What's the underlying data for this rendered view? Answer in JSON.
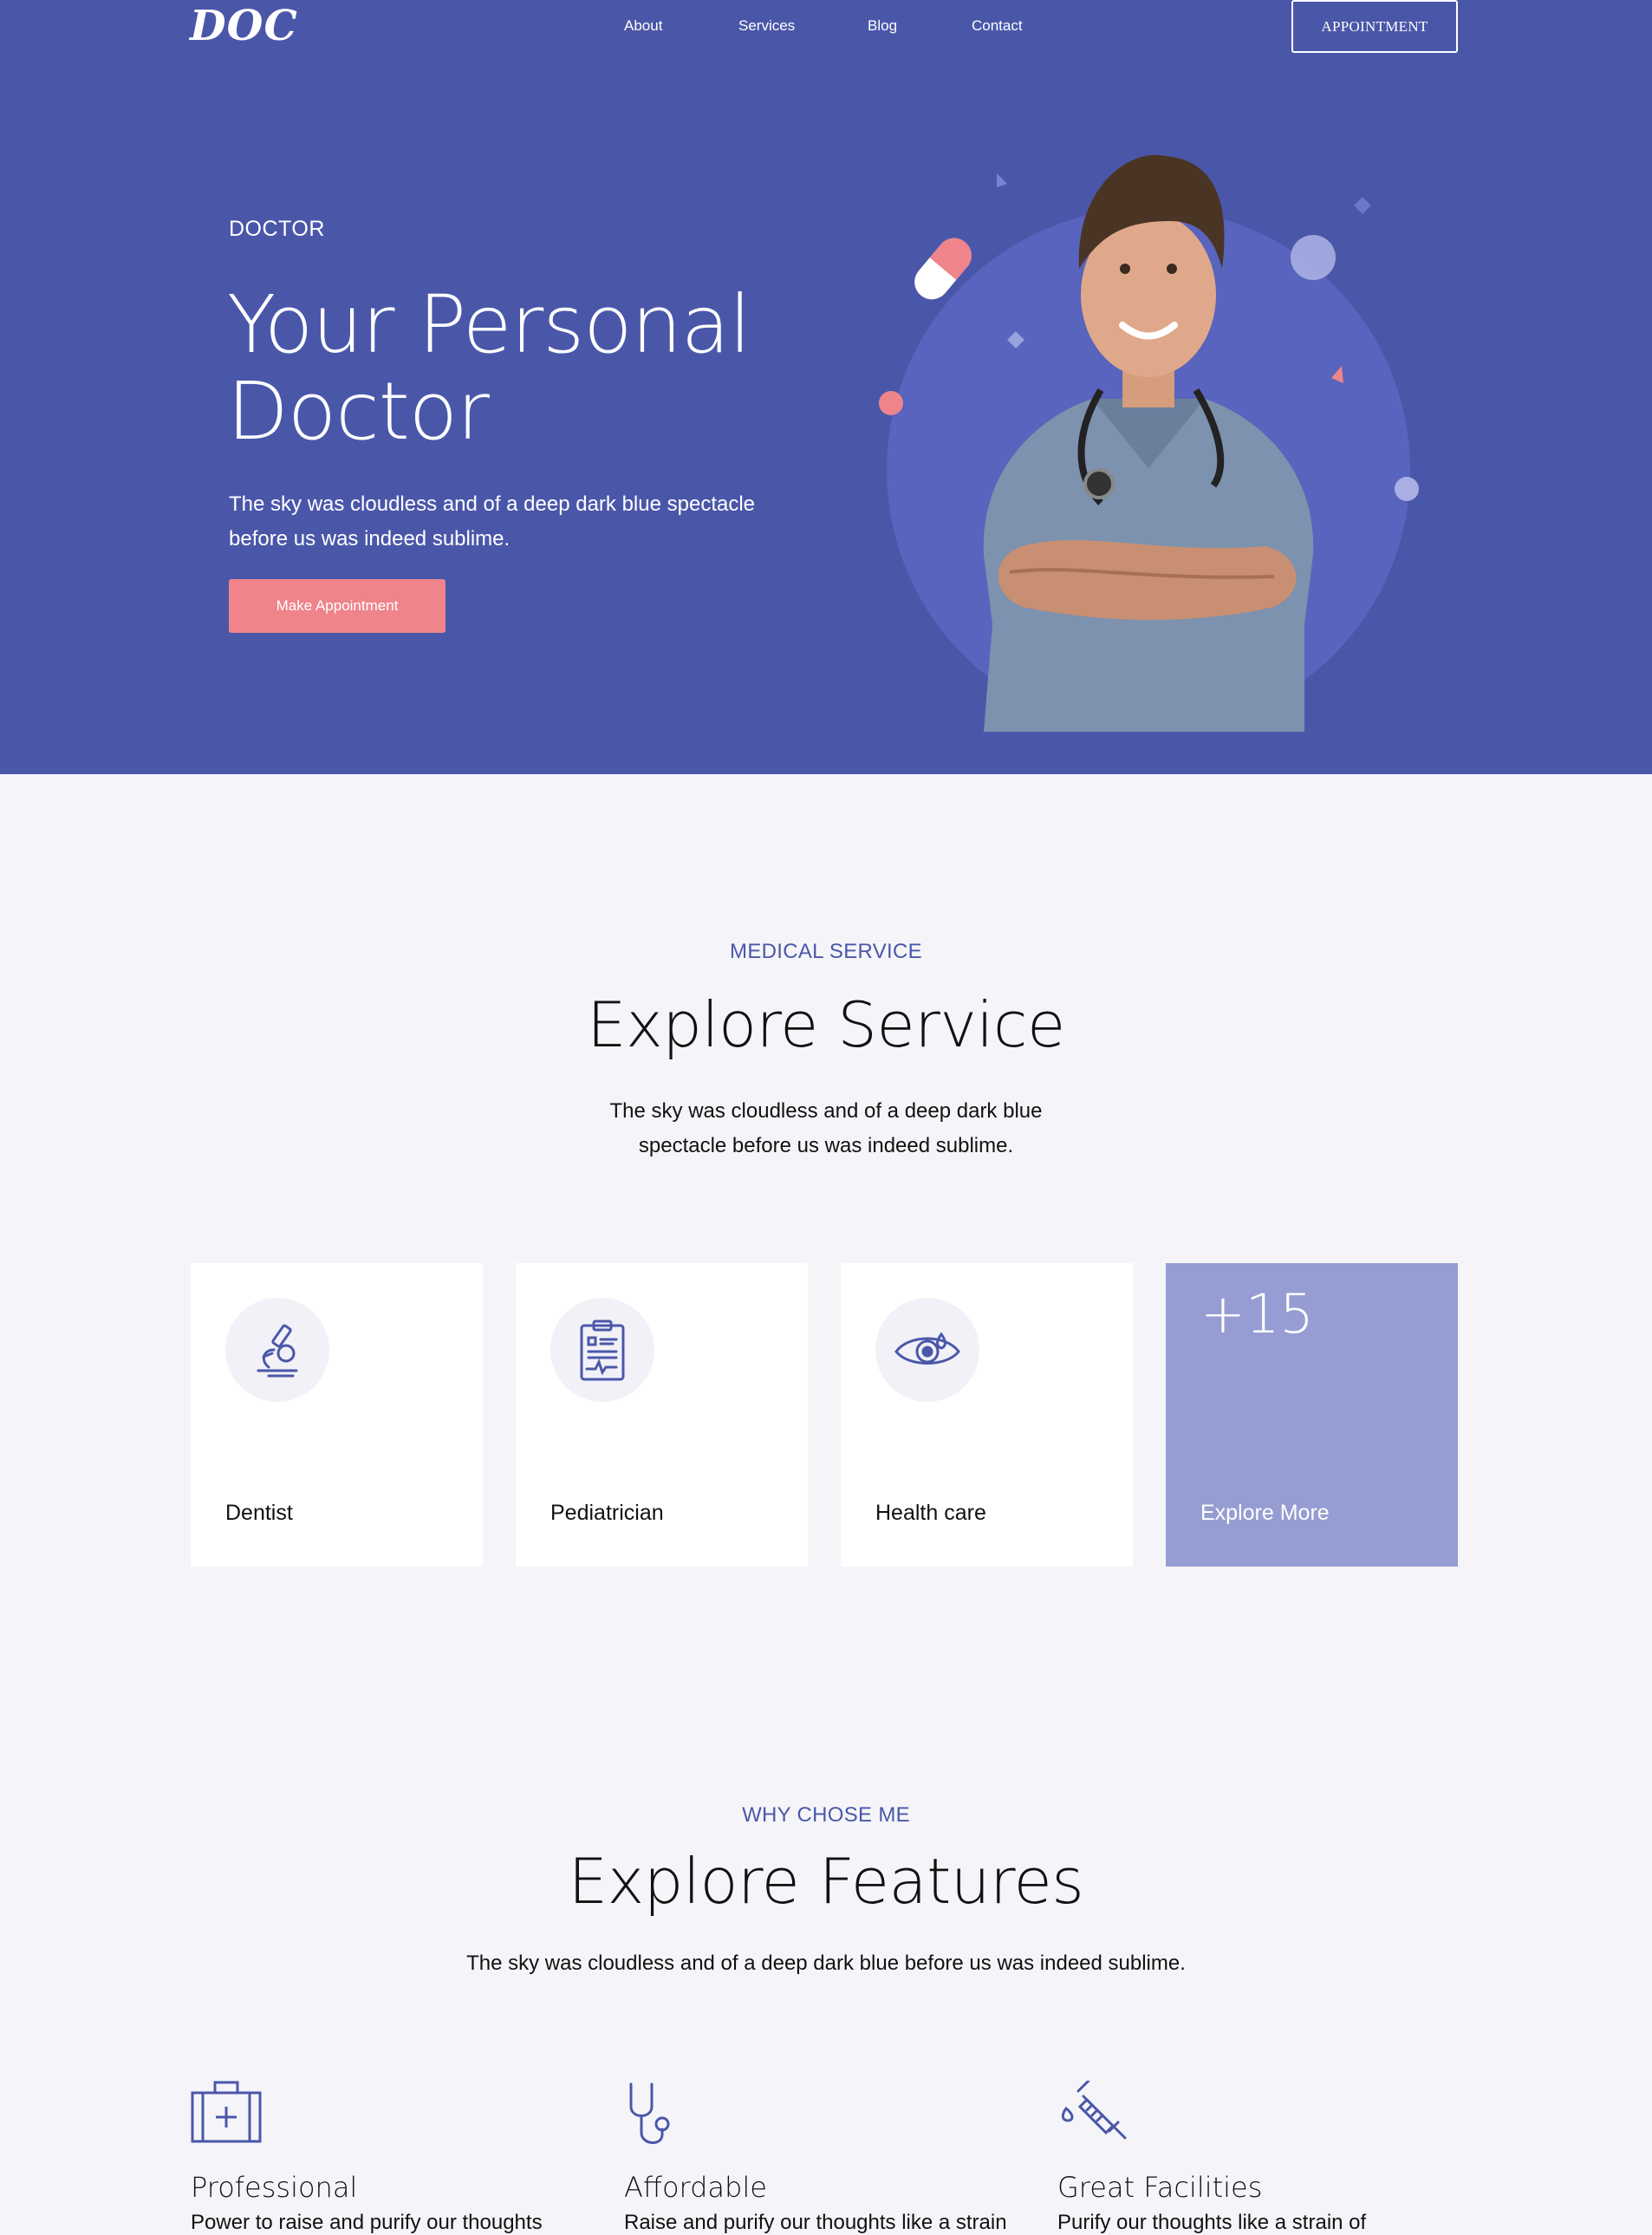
{
  "nav": {
    "logo": "DOC",
    "links": [
      "About",
      "Services",
      "Blog",
      "Contact"
    ],
    "appointment_label": "APPOINTMENT"
  },
  "hero": {
    "eyebrow": "DOCTOR",
    "title_line1": "Your Personal",
    "title_line2": "Doctor",
    "desc_line1": "The sky was cloudless and of a deep dark blue spectacle",
    "desc_line2": "before us was indeed sublime.",
    "cta_label": "Make Appointment"
  },
  "services": {
    "eyebrow": "MEDICAL SERVICE",
    "title": "Explore Service",
    "desc_line1": "The sky was cloudless and of a deep dark blue",
    "desc_line2": "spectacle before us was indeed sublime.",
    "cards": [
      {
        "label": "Dentist",
        "icon": "microscope-icon"
      },
      {
        "label": "Pediatrician",
        "icon": "clipboard-icon"
      },
      {
        "label": "Health care",
        "icon": "eye-icon"
      }
    ],
    "more": {
      "count": "+15",
      "label": "Explore More"
    }
  },
  "features": {
    "eyebrow": "WHY CHOSE ME",
    "title": "Explore Features",
    "desc": "The sky was cloudless and of a deep dark blue before us was indeed sublime.",
    "items": [
      {
        "title": "Professional",
        "desc": "Power to raise and purify our thoughts",
        "icon": "medical-kit-icon"
      },
      {
        "title": "Affordable",
        "desc": "Raise and purify our thoughts like a strain",
        "icon": "stethoscope-icon"
      },
      {
        "title": "Great Facilities",
        "desc": "Purify our thoughts like a strain of",
        "icon": "syringe-icon"
      }
    ]
  },
  "colors": {
    "primary": "#4a57a9",
    "accent": "#ef848a",
    "light_purple": "#959dd3",
    "background": "#f5f5f9"
  }
}
